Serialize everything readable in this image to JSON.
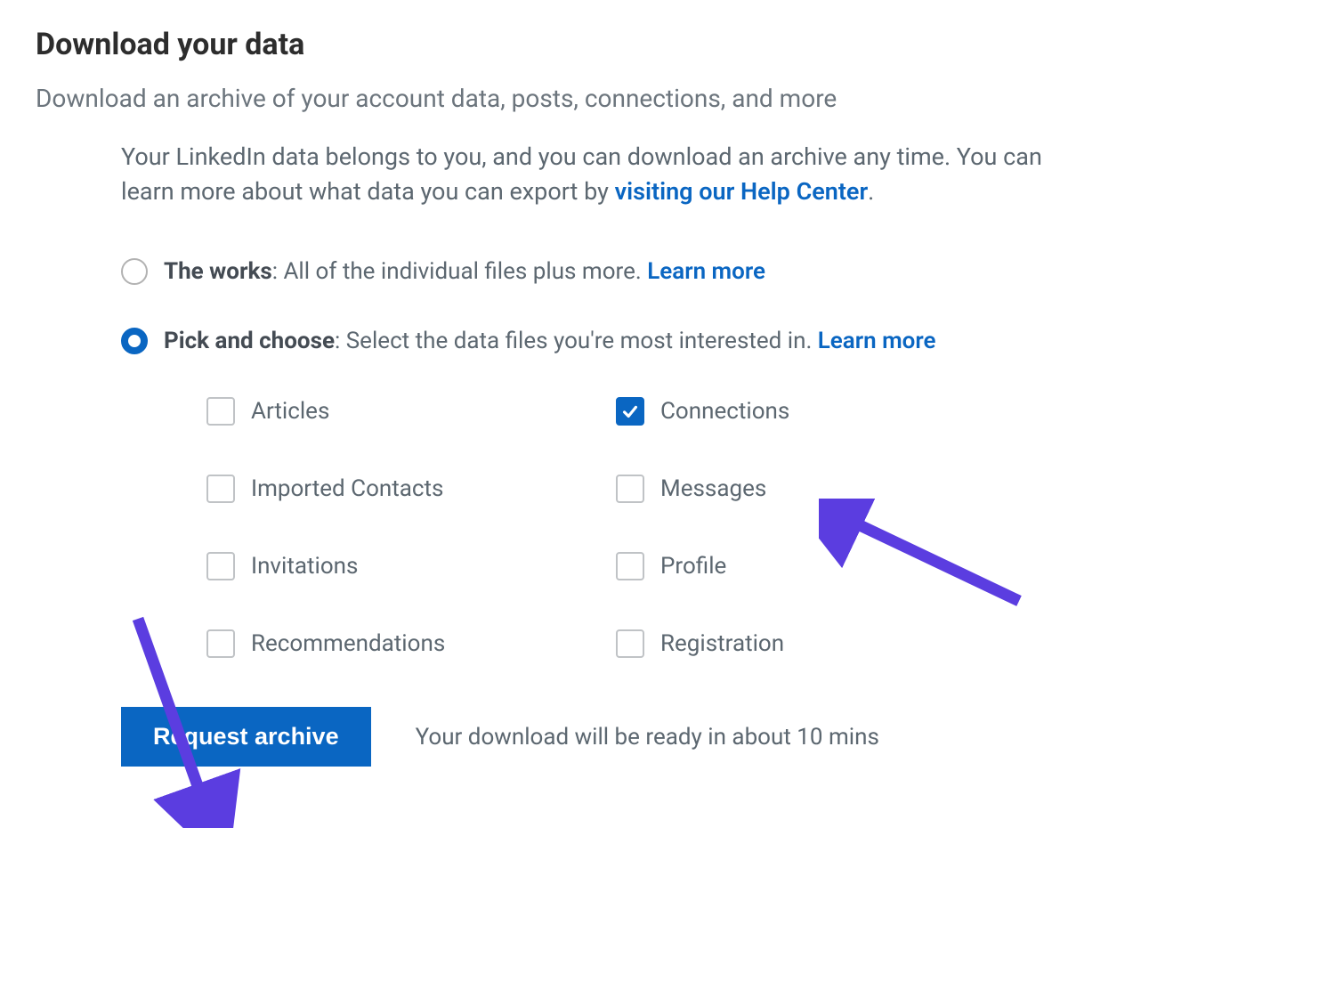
{
  "header": {
    "title": "Download your data",
    "subtitle": "Download an archive of your account data, posts, connections, and more"
  },
  "intro": {
    "text_before_link": "Your LinkedIn data belongs to you, and you can download an archive any time. You can learn more about what data you can export by ",
    "link_text": "visiting our Help Center",
    "text_after_link": "."
  },
  "radio_options": {
    "works": {
      "label_bold": "The works",
      "label_rest": ": All of the individual files plus more. ",
      "learn_more": "Learn more",
      "selected": false
    },
    "pick": {
      "label_bold": "Pick and choose",
      "label_rest": ": Select the data files you're most interested in. ",
      "learn_more": "Learn more",
      "selected": true
    }
  },
  "checkboxes": {
    "articles": {
      "label": "Articles",
      "checked": false
    },
    "connections": {
      "label": "Connections",
      "checked": true
    },
    "imported_contacts": {
      "label": "Imported Contacts",
      "checked": false
    },
    "messages": {
      "label": "Messages",
      "checked": false
    },
    "invitations": {
      "label": "Invitations",
      "checked": false
    },
    "profile": {
      "label": "Profile",
      "checked": false
    },
    "recommendations": {
      "label": "Recommendations",
      "checked": false
    },
    "registration": {
      "label": "Registration",
      "checked": false
    }
  },
  "action": {
    "button_label": "Request archive",
    "ready_text": "Your download will be ready in about 10 mins"
  },
  "colors": {
    "accent": "#0a66c2",
    "annotation_arrow": "#5b3de0"
  }
}
